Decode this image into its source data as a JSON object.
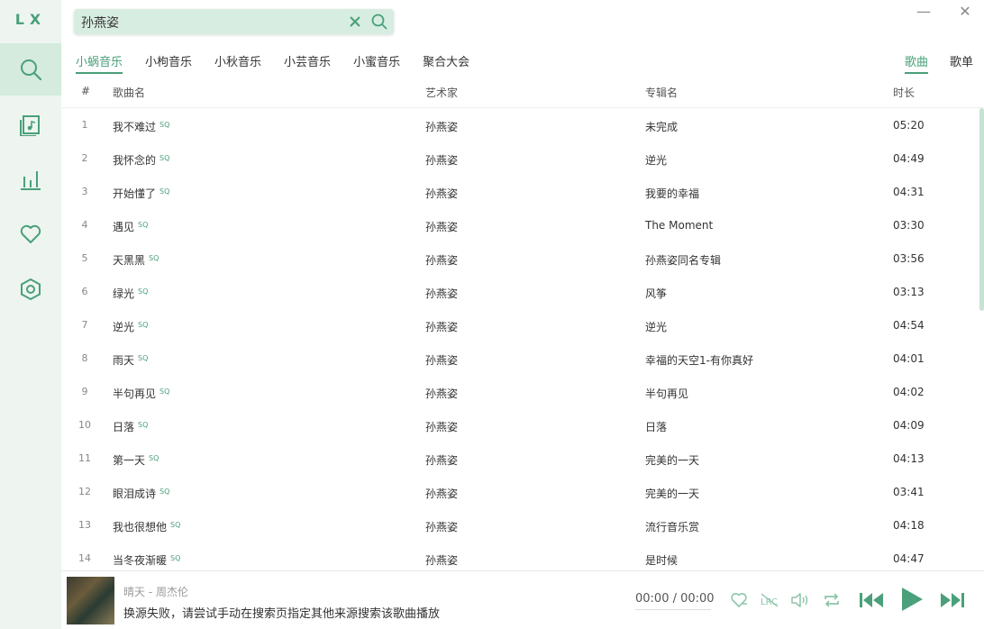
{
  "app": {
    "logo": "LX"
  },
  "search": {
    "value": "孙燕姿"
  },
  "window": {
    "minimize": "—",
    "close": "✕"
  },
  "sources": [
    "小蜗音乐",
    "小枸音乐",
    "小秋音乐",
    "小芸音乐",
    "小蜜音乐",
    "聚合大会"
  ],
  "types": [
    "歌曲",
    "歌单"
  ],
  "table": {
    "headers": {
      "num": "#",
      "name": "歌曲名",
      "artist": "艺术家",
      "album": "专辑名",
      "duration": "时长"
    },
    "rows": [
      {
        "num": "1",
        "name": "我不难过",
        "quality": "SQ",
        "artist": "孙燕姿",
        "album": "未完成",
        "duration": "05:20"
      },
      {
        "num": "2",
        "name": "我怀念的",
        "quality": "SQ",
        "artist": "孙燕姿",
        "album": "逆光",
        "duration": "04:49"
      },
      {
        "num": "3",
        "name": "开始懂了",
        "quality": "SQ",
        "artist": "孙燕姿",
        "album": "我要的幸福",
        "duration": "04:31"
      },
      {
        "num": "4",
        "name": "遇见",
        "quality": "SQ",
        "artist": "孙燕姿",
        "album": "The Moment",
        "duration": "03:30"
      },
      {
        "num": "5",
        "name": "天黑黑",
        "quality": "SQ",
        "artist": "孙燕姿",
        "album": "孙燕姿同名专辑",
        "duration": "03:56"
      },
      {
        "num": "6",
        "name": "绿光",
        "quality": "SQ",
        "artist": "孙燕姿",
        "album": "风筝",
        "duration": "03:13"
      },
      {
        "num": "7",
        "name": "逆光",
        "quality": "SQ",
        "artist": "孙燕姿",
        "album": "逆光",
        "duration": "04:54"
      },
      {
        "num": "8",
        "name": "雨天",
        "quality": "SQ",
        "artist": "孙燕姿",
        "album": "幸福的天空1-有你真好",
        "duration": "04:01"
      },
      {
        "num": "9",
        "name": "半句再见",
        "quality": "SQ",
        "artist": "孙燕姿",
        "album": "半句再见",
        "duration": "04:02"
      },
      {
        "num": "10",
        "name": "日落",
        "quality": "SQ",
        "artist": "孙燕姿",
        "album": "日落",
        "duration": "04:09"
      },
      {
        "num": "11",
        "name": "第一天",
        "quality": "SQ",
        "artist": "孙燕姿",
        "album": "完美的一天",
        "duration": "04:13"
      },
      {
        "num": "12",
        "name": "眼泪成诗",
        "quality": "SQ",
        "artist": "孙燕姿",
        "album": "完美的一天",
        "duration": "03:41"
      },
      {
        "num": "13",
        "name": "我也很想他",
        "quality": "SQ",
        "artist": "孙燕姿",
        "album": "流行音乐赏",
        "duration": "04:18"
      },
      {
        "num": "14",
        "name": "当冬夜渐暖",
        "quality": "SQ",
        "artist": "孙燕姿",
        "album": "是时候",
        "duration": "04:47"
      }
    ]
  },
  "player": {
    "title": "晴天 - 周杰伦",
    "status": "换源失败，请尝试手动在搜索页指定其他来源搜索该歌曲播放",
    "time": "00:00 / 00:00"
  },
  "colors": {
    "accent": "#4aa07a",
    "sidebar_bg": "#eef5f0",
    "active_bg": "#d4ebdd"
  }
}
